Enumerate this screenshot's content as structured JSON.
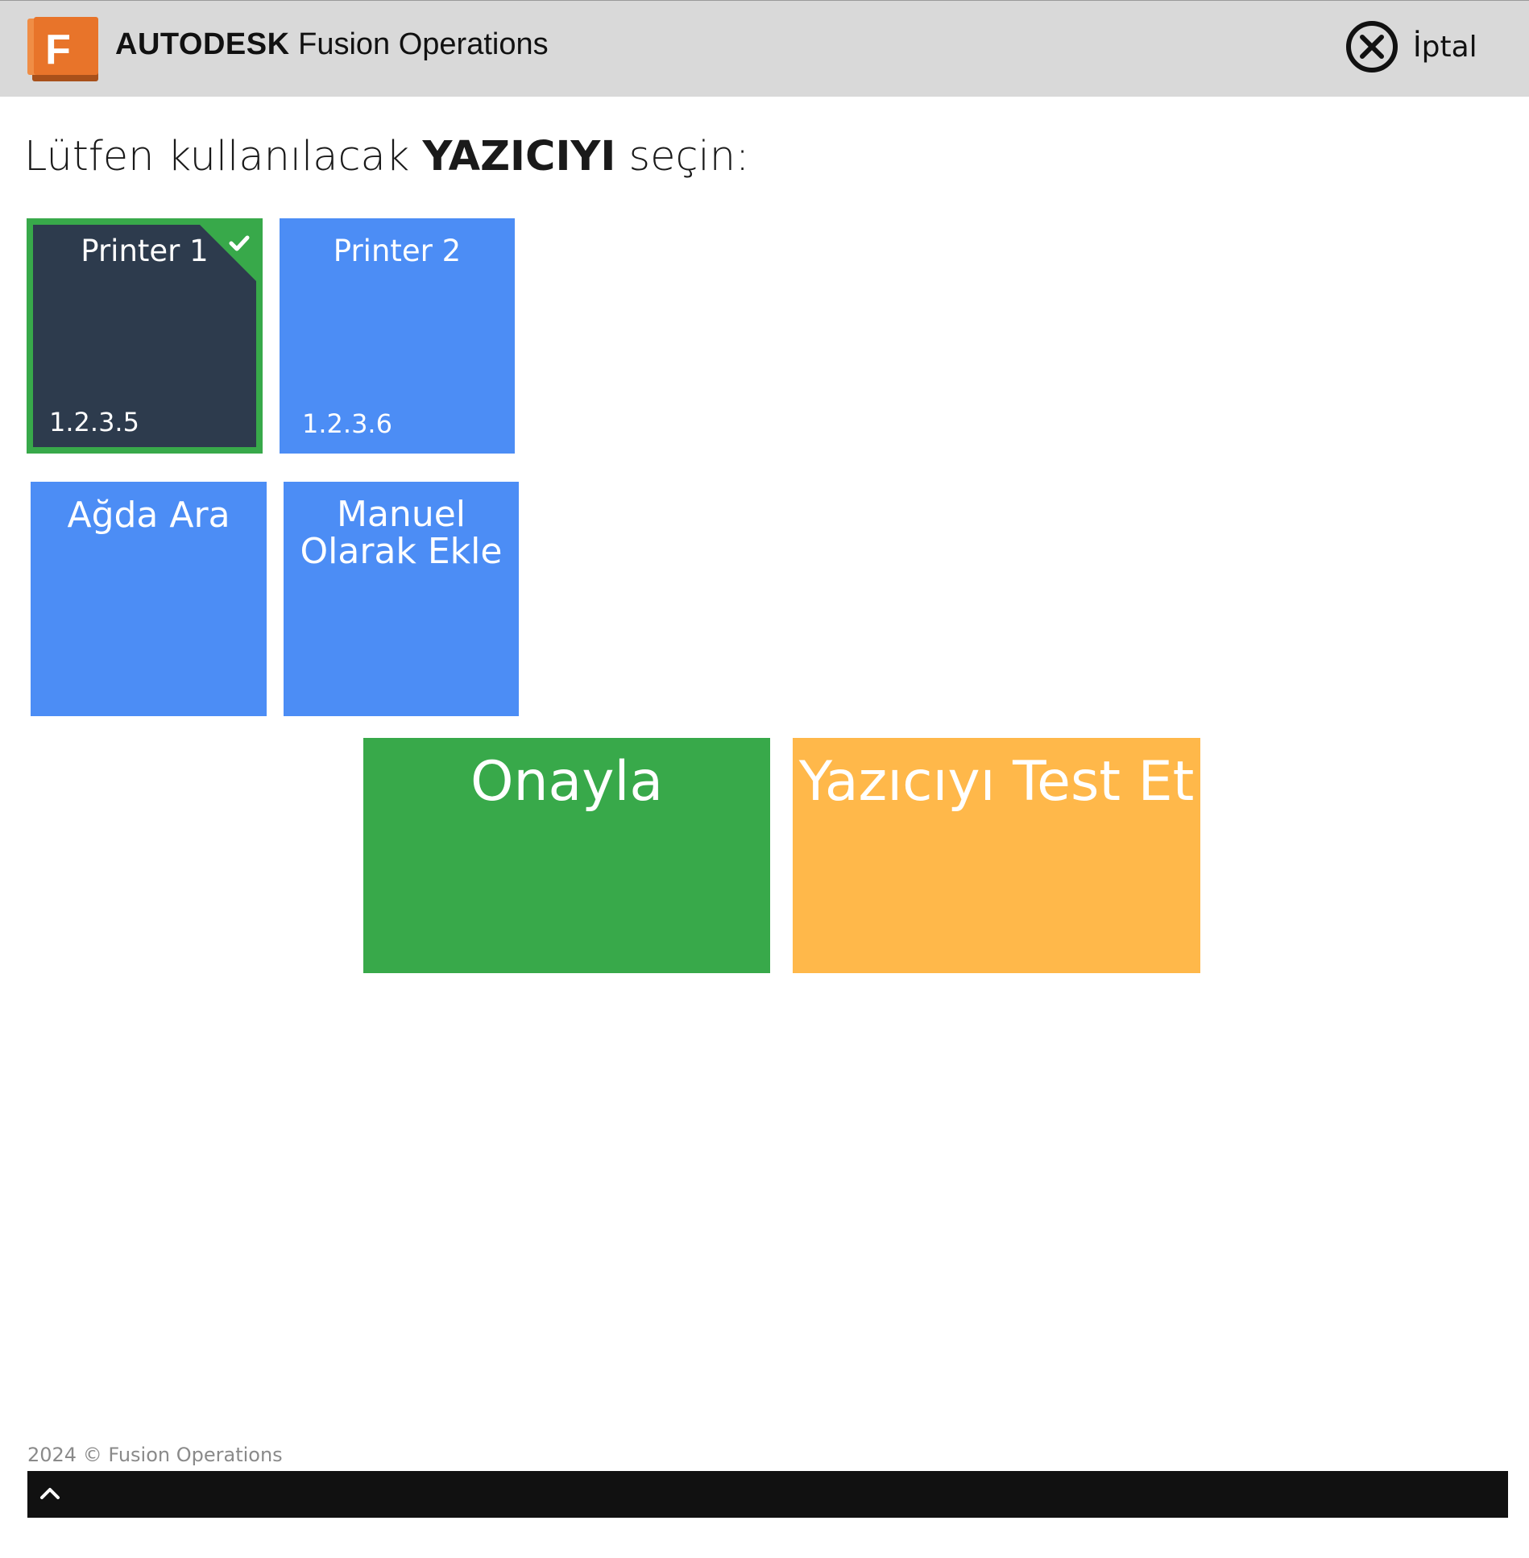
{
  "header": {
    "brand_bold": "AUTODESK",
    "brand_rest": " Fusion Operations",
    "logo_letter": "F",
    "cancel_label": "İptal",
    "cancel_icon": "close-circle-icon"
  },
  "prompt": {
    "prefix": "Lütfen kullanılacak ",
    "emphasis": "YAZICIYI",
    "suffix": " seçin:"
  },
  "printers": [
    {
      "name": "Printer 1",
      "address": "1.2.3.5",
      "selected": true
    },
    {
      "name": "Printer 2",
      "address": "1.2.3.6",
      "selected": false
    }
  ],
  "actions": {
    "search_network": "Ağda Ara",
    "manual_add_line1": "Manuel",
    "manual_add_line2": "Olarak Ekle",
    "confirm": "Onayla",
    "test_printer": "Yazıcıyı Test Et"
  },
  "footer": {
    "copyright": "2024 © Fusion Operations",
    "toggle_icon": "chevron-up-icon"
  },
  "colors": {
    "header_bg": "#d9d9d9",
    "tile_blue": "#4c8df5",
    "tile_selected": "#2d3b4d",
    "selected_border": "#38a94a",
    "confirm_green": "#38a94a",
    "test_orange": "#ffb84a",
    "logo_orange": "#e8742a"
  }
}
